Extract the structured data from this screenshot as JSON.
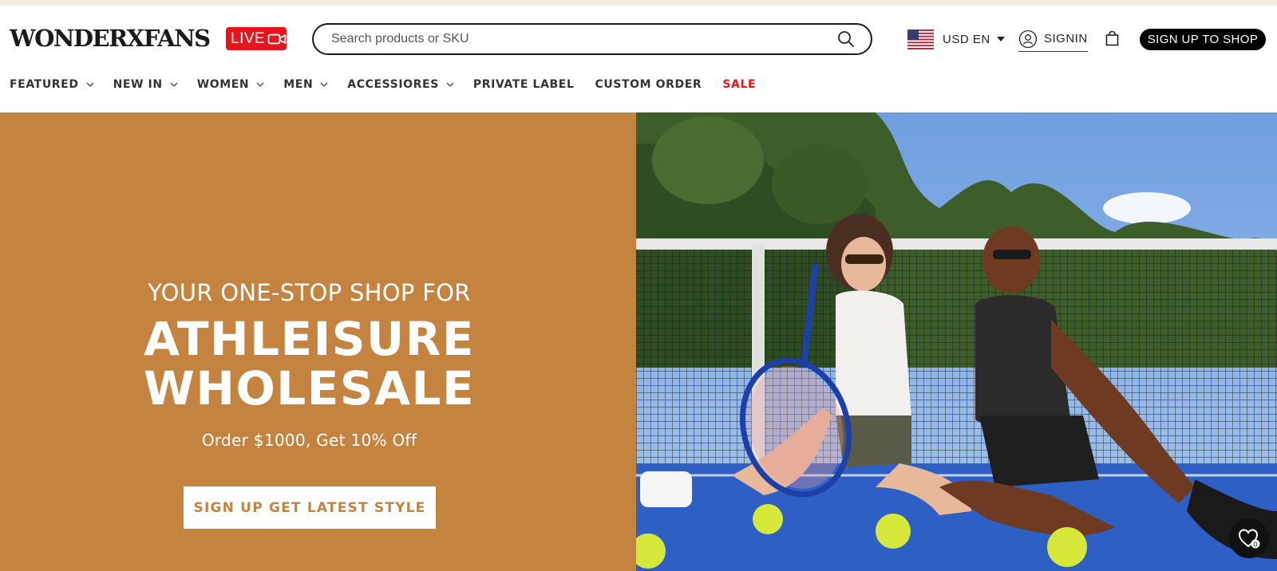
{
  "header": {
    "logo": "WONDERXFANS",
    "live_badge": "LIVE",
    "search": {
      "placeholder": "Search products or SKU",
      "value": ""
    },
    "currency": {
      "label": "USD EN",
      "flag": "us-flag-icon"
    },
    "signin_label": "SIGNIN",
    "signup_label": "SIGN UP TO SHOP"
  },
  "nav": {
    "items": [
      {
        "label": "FEATURED",
        "dropdown": true
      },
      {
        "label": "NEW IN",
        "dropdown": true
      },
      {
        "label": "WOMEN",
        "dropdown": true
      },
      {
        "label": "MEN",
        "dropdown": true
      },
      {
        "label": "ACCESSIORES",
        "dropdown": true
      },
      {
        "label": "PRIVATE LABEL",
        "dropdown": false
      },
      {
        "label": "CUSTOM ORDER",
        "dropdown": false
      },
      {
        "label": "SALE",
        "dropdown": false
      }
    ]
  },
  "hero": {
    "kicker": "YOUR ONE-STOP SHOP FOR",
    "title_line1": "ATHLEISURE",
    "title_line2": "WHOLESALE",
    "subtitle": "Order $1000, Get 10% Off",
    "cta": "SIGN UP GET LATEST STYLE"
  },
  "wishlist": {
    "count": "0"
  },
  "colors": {
    "hero_bg": "#c48440",
    "live_red": "#e4161b",
    "sale_red": "#e4161b",
    "black": "#000000"
  }
}
